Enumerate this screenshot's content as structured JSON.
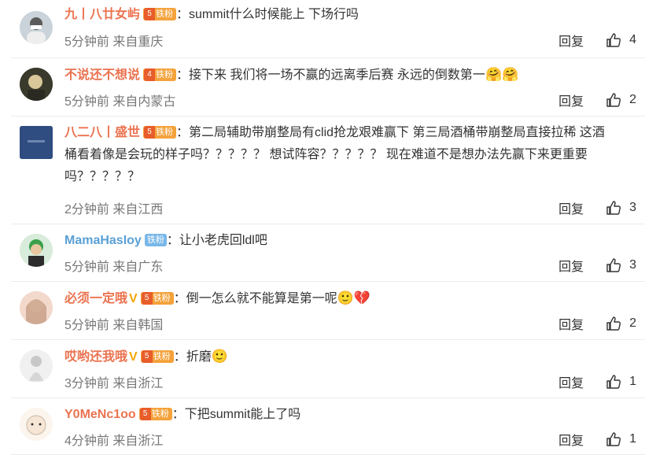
{
  "ui": {
    "reply_label": "回复",
    "colon": "："
  },
  "comments": [
    {
      "username": "九丨八廿女屿",
      "level": "5",
      "badge": "铁粉",
      "text": "summit什么时候能上 下场行吗",
      "time": "5分钟前",
      "location": "来自重庆",
      "likes": "4"
    },
    {
      "username": "不说还不想说",
      "level": "4",
      "badge": "铁粉",
      "text": "接下来 我们将一场不赢的远离季后赛 永远的倒数第一",
      "emoji": "🤗🤗",
      "time": "5分钟前",
      "location": "来自内蒙古",
      "likes": "2"
    },
    {
      "username": "八二八丨盛世",
      "level": "5",
      "badge": "铁粉",
      "text_lines": [
        "第二局辅助带崩整局有clid抢龙艰难赢下 第三局酒桶带崩整局直接拉稀 这酒",
        "桶看着像是会玩的样子吗？？？？？ 想试阵容？？？？？ 现在难道不是想办法先赢下来更重要",
        "吗？？？？？"
      ],
      "time": "2分钟前",
      "location": "来自江西",
      "likes": "3"
    },
    {
      "username": "MamaHasIoy",
      "badge": "铁粉",
      "text": "让小老虎回ldl吧",
      "time": "5分钟前",
      "location": "来自广东",
      "likes": "3"
    },
    {
      "username": "必须一定哦",
      "level": "5",
      "badge": "铁粉",
      "text": "倒一怎么就不能算是第一呢",
      "emoji": "🙂💔",
      "time": "5分钟前",
      "location": "来自韩国",
      "likes": "2"
    },
    {
      "username": "哎哟还我哦",
      "level": "5",
      "badge": "铁粉",
      "text": "折磨",
      "emoji": "🙂",
      "time": "3分钟前",
      "location": "来自浙江",
      "likes": "1"
    },
    {
      "username": "Y0MeNc1oo",
      "level": "5",
      "badge": "铁粉",
      "text": "下把summit能上了吗",
      "time": "4分钟前",
      "location": "来自浙江",
      "likes": "1"
    }
  ]
}
